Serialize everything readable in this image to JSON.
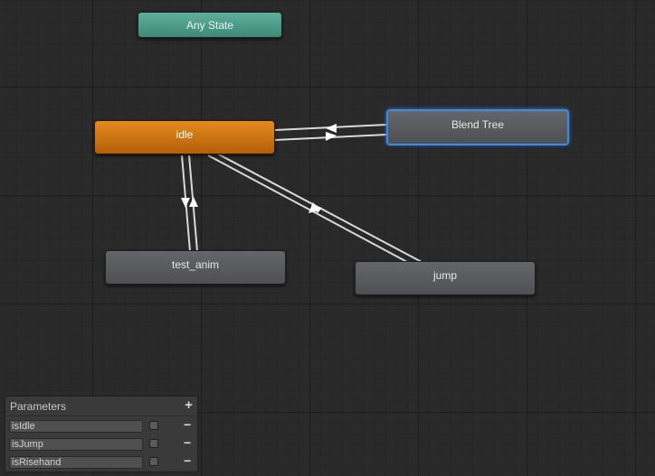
{
  "graph": {
    "nodes": [
      {
        "id": "any_state",
        "label": "Any State",
        "kind": "anystate"
      },
      {
        "id": "idle",
        "label": "idle",
        "kind": "entry"
      },
      {
        "id": "blend_tree",
        "label": "Blend Tree",
        "kind": "selected"
      },
      {
        "id": "test_anim",
        "label": "test_anim",
        "kind": "default"
      },
      {
        "id": "jump",
        "label": "jump",
        "kind": "default"
      }
    ],
    "transitions": [
      {
        "from": "idle",
        "to": "blend_tree"
      },
      {
        "from": "blend_tree",
        "to": "idle"
      },
      {
        "from": "idle",
        "to": "test_anim"
      },
      {
        "from": "test_anim",
        "to": "idle"
      },
      {
        "from": "idle",
        "to": "jump"
      },
      {
        "from": "jump",
        "to": "idle"
      }
    ],
    "colors": {
      "anystate": "#4f9e8c",
      "entry": "#d07a14",
      "default": "#56585c",
      "selected_border": "#3d8ae0",
      "transition": "#d8d8d8"
    }
  },
  "parameters": {
    "title": "Parameters",
    "add_icon": "+",
    "items": [
      {
        "name": "isIdle",
        "value": false,
        "remove_icon": "−"
      },
      {
        "name": "isJump",
        "value": false,
        "remove_icon": "−"
      },
      {
        "name": "isRisehand",
        "value": false,
        "remove_icon": "−"
      }
    ]
  }
}
